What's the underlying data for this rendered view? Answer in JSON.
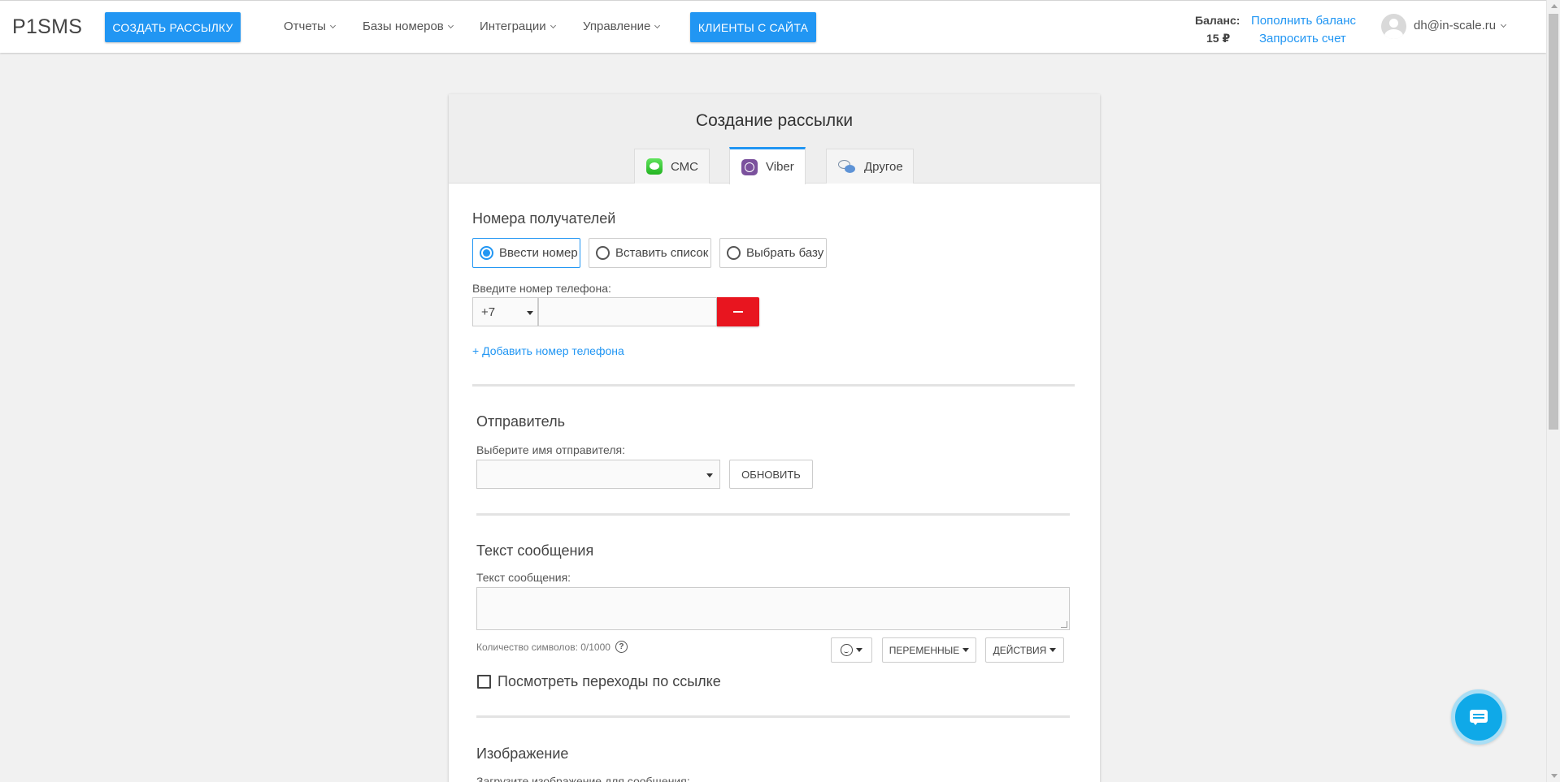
{
  "header": {
    "logo": "P1SMS",
    "create_button": "Создать рассылку",
    "nav": [
      {
        "label": "Отчеты"
      },
      {
        "label": "Базы номеров"
      },
      {
        "label": "Интеграции"
      },
      {
        "label": "Управление"
      }
    ],
    "clients_button": "Клиенты с сайта",
    "balance_label": "Баланс:",
    "balance_value": "15 ₽",
    "topup_link": "Пополнить баланс",
    "invoice_link": "Запросить счет",
    "user_email": "dh@in-scale.ru"
  },
  "card": {
    "title": "Создание рассылки",
    "tabs": [
      {
        "label": "СМС",
        "icon": "sms-icon",
        "active": false
      },
      {
        "label": "Viber",
        "icon": "viber-icon",
        "active": true
      },
      {
        "label": "Другое",
        "icon": "chat-bubbles-icon",
        "active": false
      }
    ]
  },
  "recipients": {
    "title": "Номера получателей",
    "options": [
      {
        "label": "Ввести номер",
        "checked": true
      },
      {
        "label": "Вставить список",
        "checked": false
      },
      {
        "label": "Выбрать базу",
        "checked": false
      }
    ],
    "phone_label": "Введите номер телефона:",
    "country_code": "+7",
    "phone_value": "",
    "add_phone_link": "+ Добавить номер телефона"
  },
  "sender": {
    "title": "Отправитель",
    "select_label": "Выберите имя отправителя:",
    "selected": "",
    "refresh_button": "Обновить"
  },
  "message": {
    "title": "Текст сообщения",
    "field_label": "Текст сообщения:",
    "value": "",
    "char_count": "Количество символов: 0/1000",
    "variables_button": "Переменные",
    "actions_button": "Действия",
    "track_clicks_label": "Посмотреть переходы по ссылке",
    "track_clicks_checked": false
  },
  "image": {
    "title": "Изображение",
    "upload_label": "Загрузите изображение для сообщения:"
  },
  "colors": {
    "accent": "#2196f3",
    "danger": "#e8151f",
    "chat": "#0fa9e8"
  }
}
